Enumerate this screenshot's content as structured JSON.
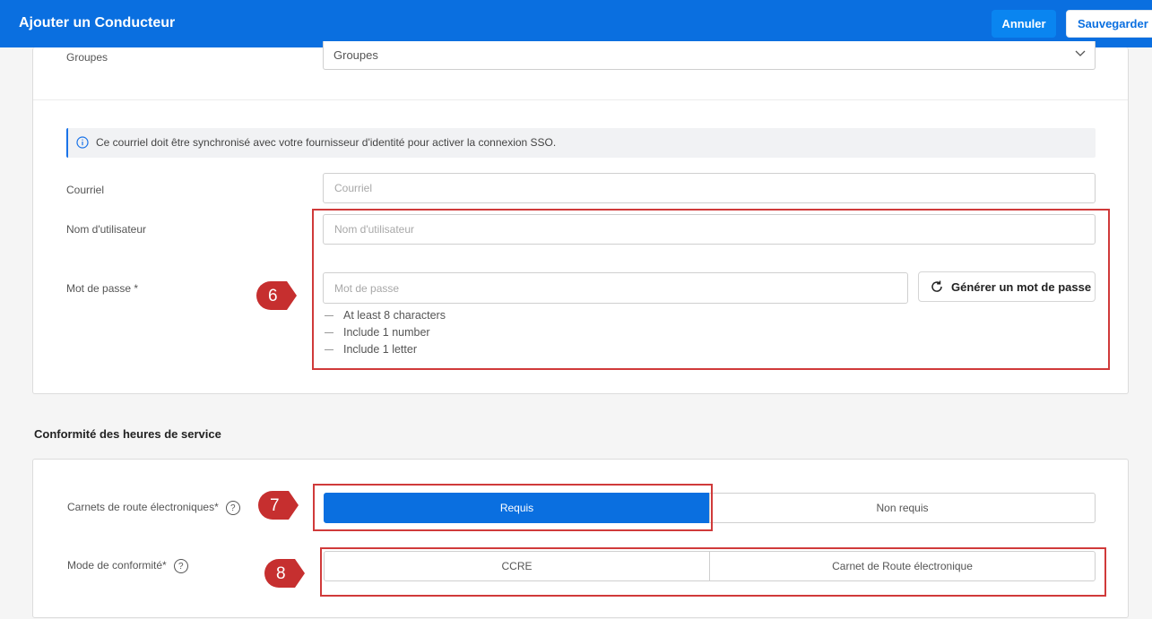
{
  "header": {
    "title": "Ajouter un Conducteur",
    "cancel_label": "Annuler",
    "save_label": "Sauvegarder"
  },
  "groups": {
    "label": "Groupes",
    "value": "Groupes"
  },
  "sso_notice": "Ce courriel doit être synchronisé avec votre fournisseur d'identité pour activer la connexion SSO.",
  "email": {
    "label": "Courriel",
    "placeholder": "Courriel"
  },
  "username": {
    "label": "Nom d'utilisateur",
    "placeholder": "Nom d'utilisateur"
  },
  "password": {
    "label": "Mot de passe *",
    "placeholder": "Mot de passe",
    "generate_label": "Générer un mot de passe",
    "rules": [
      "At least 8 characters",
      "Include 1 number",
      "Include 1 letter"
    ]
  },
  "hos": {
    "title": "Conformité des heures de service",
    "eld_label": "Carnets de route électroniques*",
    "eld_options": [
      "Requis",
      "Non requis"
    ],
    "mode_label": "Mode de conformité*",
    "mode_options": [
      "CCRE",
      "Carnet de Route électronique"
    ]
  },
  "annotations": [
    "6",
    "7",
    "8"
  ],
  "colors": {
    "primary": "#0a6fe0",
    "highlight": "#d03a3a"
  }
}
